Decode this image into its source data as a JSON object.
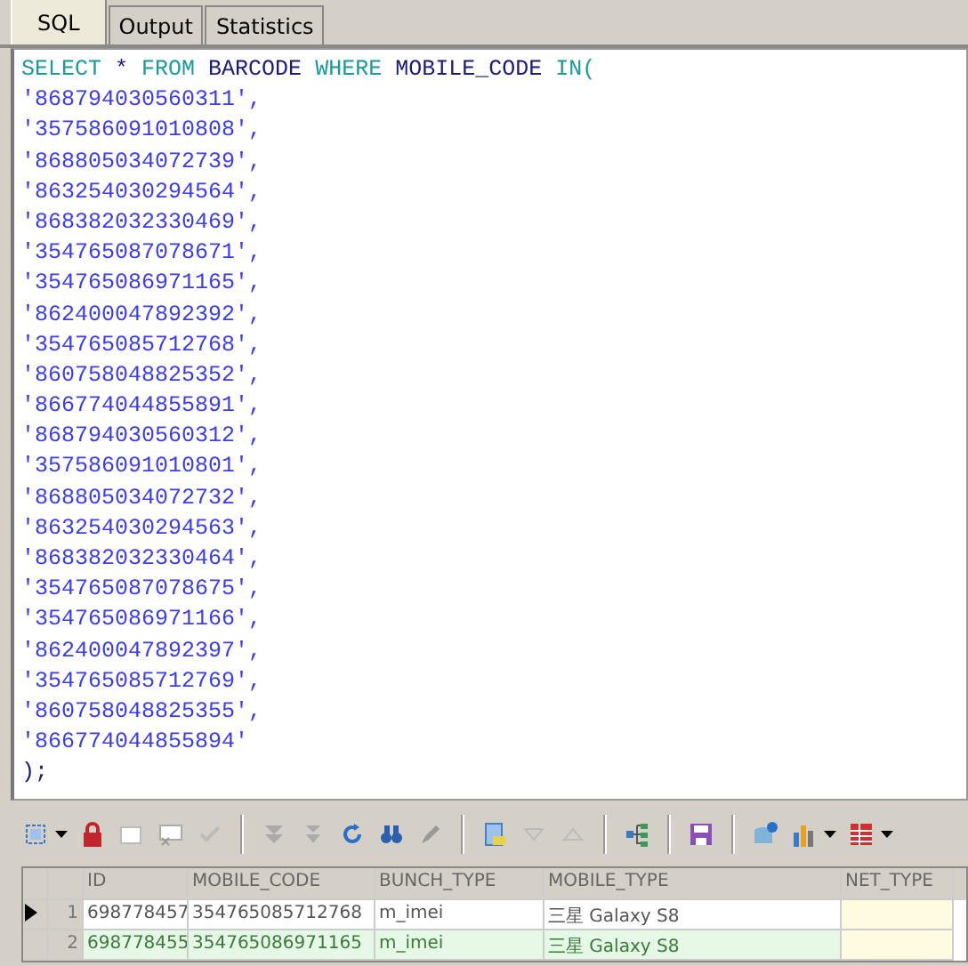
{
  "tabs": [
    {
      "label": "SQL",
      "selected": true
    },
    {
      "label": "Output",
      "selected": false
    },
    {
      "label": "Statistics",
      "selected": false
    }
  ],
  "editor": {
    "lines": [
      [
        {
          "kind": "keyword",
          "text": "SELECT"
        },
        {
          "kind": "plain",
          "text": " * "
        },
        {
          "kind": "keyword",
          "text": "FROM"
        },
        {
          "kind": "plain",
          "text": " BARCODE "
        },
        {
          "kind": "keyword",
          "text": "WHERE"
        },
        {
          "kind": "plain",
          "text": " MOBILE_CODE "
        },
        {
          "kind": "keyword",
          "text": "IN("
        }
      ],
      [
        {
          "kind": "string",
          "text": "'868794030560311',"
        }
      ],
      [
        {
          "kind": "string",
          "text": "'357586091010808',"
        }
      ],
      [
        {
          "kind": "string",
          "text": "'868805034072739',"
        }
      ],
      [
        {
          "kind": "string",
          "text": "'863254030294564',"
        }
      ],
      [
        {
          "kind": "string",
          "text": "'868382032330469',"
        }
      ],
      [
        {
          "kind": "string",
          "text": "'354765087078671',"
        }
      ],
      [
        {
          "kind": "string",
          "text": "'354765086971165',"
        }
      ],
      [
        {
          "kind": "string",
          "text": "'862400047892392',"
        }
      ],
      [
        {
          "kind": "string",
          "text": "'354765085712768',"
        }
      ],
      [
        {
          "kind": "string",
          "text": "'860758048825352',"
        }
      ],
      [
        {
          "kind": "string",
          "text": "'866774044855891',"
        }
      ],
      [
        {
          "kind": "string",
          "text": "'868794030560312',"
        }
      ],
      [
        {
          "kind": "string",
          "text": "'357586091010801',"
        }
      ],
      [
        {
          "kind": "string",
          "text": "'868805034072732',"
        }
      ],
      [
        {
          "kind": "string",
          "text": "'863254030294563',"
        }
      ],
      [
        {
          "kind": "string",
          "text": "'868382032330464',"
        }
      ],
      [
        {
          "kind": "string",
          "text": "'354765087078675',"
        }
      ],
      [
        {
          "kind": "string",
          "text": "'354765086971166',"
        }
      ],
      [
        {
          "kind": "string",
          "text": "'862400047892397',"
        }
      ],
      [
        {
          "kind": "string",
          "text": "'354765085712769',"
        }
      ],
      [
        {
          "kind": "string",
          "text": "'860758048825355',"
        }
      ],
      [
        {
          "kind": "string",
          "text": "'866774044855894'"
        }
      ],
      [
        {
          "kind": "plain",
          "text": ");"
        }
      ]
    ]
  },
  "grid": {
    "columns": [
      "ID",
      "MOBILE_CODE",
      "BUNCH_TYPE",
      "MOBILE_TYPE",
      "NET_TYPE"
    ],
    "rows": [
      {
        "selected": true,
        "number": "1",
        "id": "698778457",
        "mobile_code": "354765085712768",
        "bunch_type": "m_imei",
        "mobile_type": "三星 Galaxy S8"
      },
      {
        "selected": false,
        "number": "2",
        "id": "698778455",
        "mobile_code": "354765086971165",
        "bunch_type": "m_imei",
        "mobile_type": "三星 Galaxy S8"
      }
    ]
  }
}
